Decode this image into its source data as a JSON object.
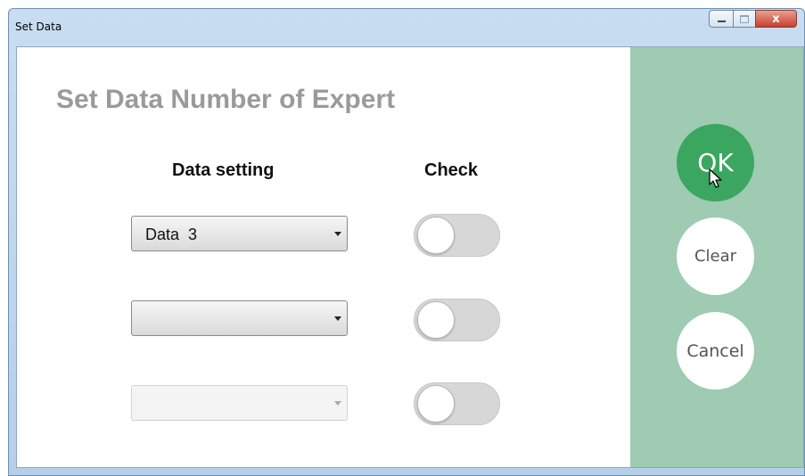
{
  "window": {
    "title": "Set Data",
    "controls": {
      "minimize_icon": "minimize-icon",
      "maximize_icon": "maximize-icon",
      "close_glyph": "x"
    }
  },
  "main": {
    "heading": "Set Data Number of Expert",
    "columns": {
      "data_setting": "Data setting",
      "check": "Check"
    },
    "rows": [
      {
        "combo_value": "Data  3",
        "combo_enabled": true,
        "check_on": false
      },
      {
        "combo_value": "",
        "combo_enabled": true,
        "check_on": false
      },
      {
        "combo_value": "",
        "combo_enabled": false,
        "check_on": false
      }
    ]
  },
  "sidebar": {
    "ok_label": "OK",
    "clear_label": "Clear",
    "cancel_label": "Cancel"
  },
  "colors": {
    "sidebar_bg": "#9ecbb1",
    "ok_bg": "#3aa660",
    "heading_text": "#9a9a9a"
  }
}
